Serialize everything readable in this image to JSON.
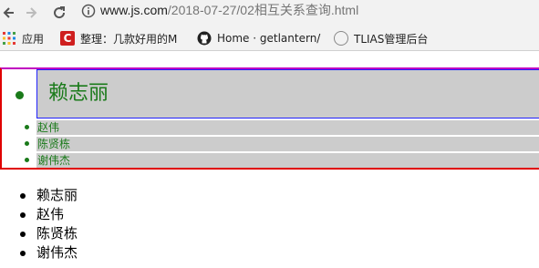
{
  "browser": {
    "url_host": "www.js.com",
    "url_path": "/2018-07-27/02相互关系查询.html",
    "bookmarks": [
      {
        "label": "应用"
      },
      {
        "label": "整理：几款好用的M"
      },
      {
        "label": "Home · getlantern/"
      },
      {
        "label": "TLIAS管理后台"
      }
    ]
  },
  "page": {
    "styled_list": {
      "first": "赖志丽",
      "items": [
        "赵伟",
        "陈贤栋",
        "谢伟杰"
      ]
    },
    "plain_list": [
      "赖志丽",
      "赵伟",
      "陈贤栋",
      "谢伟杰"
    ]
  },
  "colors": {
    "green_text": "#1a7a1a",
    "item_bg": "#cccccc",
    "outer_border": "#e00000",
    "first_border": "#2020ff"
  }
}
